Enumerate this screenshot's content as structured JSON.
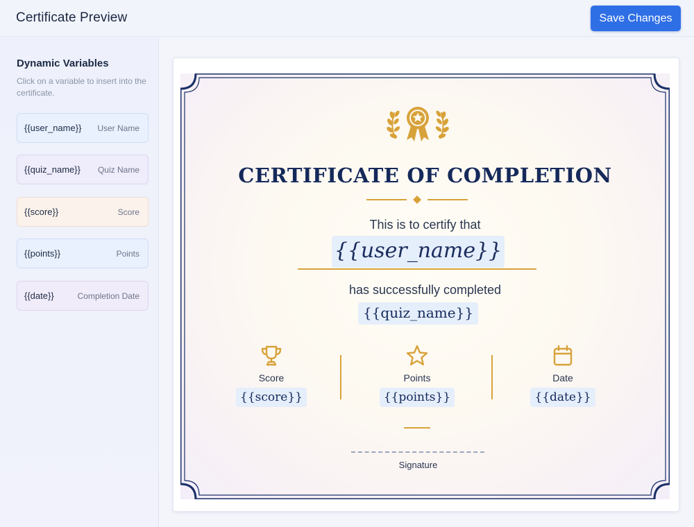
{
  "header": {
    "title": "Certificate Preview",
    "save_label": "Save Changes"
  },
  "sidebar": {
    "title": "Dynamic Variables",
    "help": "Click on a variable to insert into the certificate.",
    "items": [
      {
        "token": "{{user_name}}",
        "label": "User Name"
      },
      {
        "token": "{{quiz_name}}",
        "label": "Quiz Name"
      },
      {
        "token": "{{score}}",
        "label": "Score"
      },
      {
        "token": "{{points}}",
        "label": "Points"
      },
      {
        "token": "{{date}}",
        "label": "Completion Date"
      }
    ]
  },
  "certificate": {
    "title": "CERTIFICATE OF COMPLETION",
    "certify_text": "This is to certify that",
    "user_token": "{{user_name}}",
    "completed_text": "has successfully completed",
    "quiz_token": "{{quiz_name}}",
    "stats": [
      {
        "icon": "trophy-icon",
        "label": "Score",
        "token": "{{score}}"
      },
      {
        "icon": "star-icon",
        "label": "Points",
        "token": "{{points}}"
      },
      {
        "icon": "calendar-icon",
        "label": "Date",
        "token": "{{date}}"
      }
    ],
    "signature_label": "Signature"
  },
  "colors": {
    "accent_blue": "#2f6fe6",
    "navy": "#15295a",
    "gold": "#d8a23a",
    "token_bg": "#e5eefb"
  }
}
